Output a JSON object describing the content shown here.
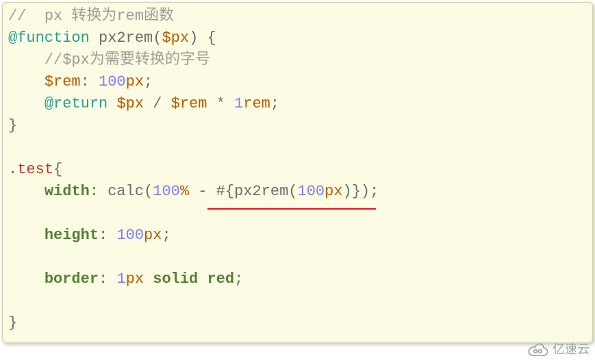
{
  "code": {
    "l1": {
      "comment_prefix": "//",
      "space": "  ",
      "px_word": "px",
      "cn_text": " 转换为",
      "rem_word": "rem",
      "fn_text": "函数"
    },
    "l2": {
      "atrule": "@function",
      "fname": "px2rem",
      "lparen": "(",
      "arg": "$px",
      "rparen": ")",
      "lbrace": "{"
    },
    "l3": {
      "indent": "    ",
      "comment": "//$px为需要转换的字号"
    },
    "l4": {
      "indent": "    ",
      "var": "$rem",
      "colon": ":",
      "num": "100",
      "unit": "px",
      "semi": ";"
    },
    "l5": {
      "indent": "    ",
      "atrule": "@return",
      "a": "$px",
      "op1": "/",
      "b": "$rem",
      "op2": "*",
      "num": "1",
      "unit": "rem",
      "semi": ";"
    },
    "l6": {
      "rbrace": "}"
    },
    "l7": "",
    "l8": {
      "sel": ".test",
      "lbrace": "{"
    },
    "l9": {
      "indent": "    ",
      "prop": "width",
      "colon": ":",
      "calc": "calc",
      "lparen": "(",
      "num": "100",
      "pct": "%",
      "minus": "-",
      "interp_open": "#{",
      "fn": "px2rem",
      "lparen2": "(",
      "num2": "100",
      "unit2": "px",
      "rparen2": ")",
      "interp_close": "}",
      "rparen": ")",
      "semi": ";"
    },
    "l10": "",
    "l11": {
      "indent": "    ",
      "prop": "height",
      "colon": ":",
      "num": "100",
      "unit": "px",
      "semi": ";"
    },
    "l12": "",
    "l13": {
      "indent": "    ",
      "prop": "border",
      "colon": ":",
      "num": "1",
      "unit": "px",
      "kw": "solid",
      "color": "red",
      "semi": ";"
    },
    "l14": "",
    "l15": {
      "rbrace": "}"
    }
  },
  "watermark": {
    "text": "亿速云"
  }
}
